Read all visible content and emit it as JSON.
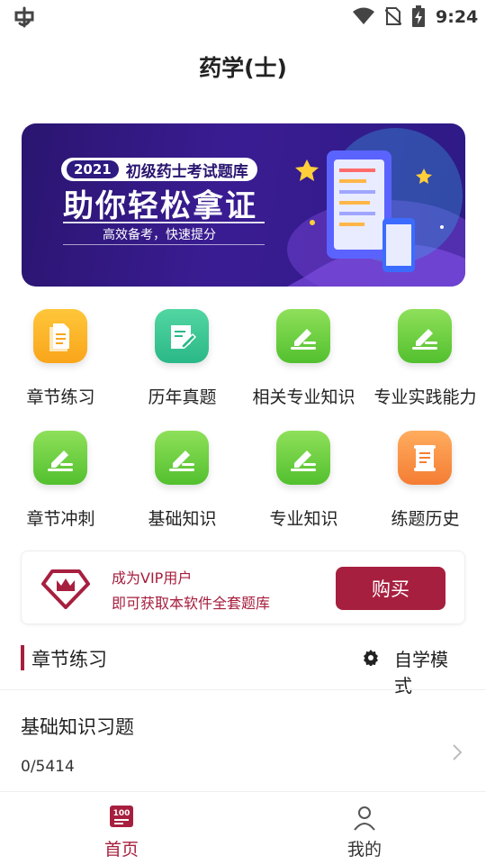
{
  "status": {
    "time": "9:24"
  },
  "header": {
    "title": "药学(士)"
  },
  "banner": {
    "year": "2021",
    "line1": "初级药士考试题库",
    "headline": "助你轻松拿证",
    "subline": "高效备考，快速提分"
  },
  "grid": [
    {
      "label": "章节练习",
      "icon": "document-icon",
      "color": "#f9a51a"
    },
    {
      "label": "历年真题",
      "icon": "note-edit-icon",
      "color": "#2ab887"
    },
    {
      "label": "相关专业知识",
      "icon": "pencil-icon",
      "color": "#52c02e"
    },
    {
      "label": "专业实践能力",
      "icon": "pencil-icon",
      "color": "#52c02e"
    },
    {
      "label": "章节冲刺",
      "icon": "pencil-icon",
      "color": "#52c02e"
    },
    {
      "label": "基础知识",
      "icon": "pencil-icon",
      "color": "#52c02e"
    },
    {
      "label": "专业知识",
      "icon": "pencil-icon",
      "color": "#52c02e"
    },
    {
      "label": "练题历史",
      "icon": "scroll-icon",
      "color": "#f47d33"
    }
  ],
  "vip": {
    "line1": "成为VIP用户",
    "line2": "即可获取本软件全套题库",
    "buy_label": "购买",
    "accent": "#a71f3f"
  },
  "section": {
    "title": "章节练习",
    "mode_label": "自学模式"
  },
  "list": [
    {
      "name": "基础知识习题",
      "progress": "0/5414"
    }
  ],
  "tabs": [
    {
      "label": "首页",
      "icon": "home-book-icon",
      "active": true
    },
    {
      "label": "我的",
      "icon": "person-icon",
      "active": false
    }
  ]
}
